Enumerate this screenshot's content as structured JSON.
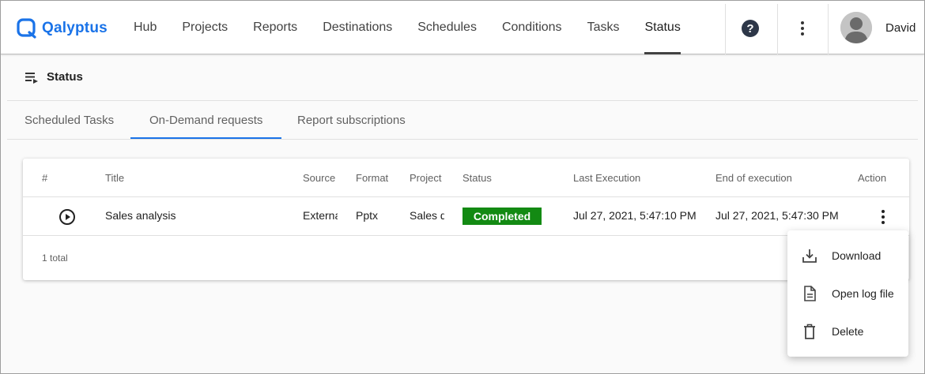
{
  "app": {
    "brand": "Qalyptus",
    "brand_color": "#1a73e8"
  },
  "nav": {
    "items": [
      {
        "label": "Hub"
      },
      {
        "label": "Projects"
      },
      {
        "label": "Reports"
      },
      {
        "label": "Destinations"
      },
      {
        "label": "Schedules"
      },
      {
        "label": "Conditions"
      },
      {
        "label": "Tasks"
      },
      {
        "label": "Status",
        "active": true
      }
    ],
    "help_label": "?",
    "help_icon": "help-circle-icon",
    "more_icon": "more-vertical-icon",
    "user_name": "David",
    "avatar_icon": "user-avatar-icon"
  },
  "page": {
    "title": "Status",
    "title_icon": "playlist-play-icon"
  },
  "tabs": [
    {
      "label": "Scheduled Tasks"
    },
    {
      "label": "On-Demand requests",
      "active": true
    },
    {
      "label": "Report subscriptions"
    }
  ],
  "table": {
    "columns": [
      "#",
      "Title",
      "Source",
      "Format",
      "Project",
      "Status",
      "Last Execution",
      "End of execution",
      "Action"
    ],
    "rows": [
      {
        "run_icon": "play-circle-icon",
        "title": "Sales analysis",
        "source": "External",
        "format": "Pptx",
        "project": "Sales dashboard",
        "status": "Completed",
        "status_color": "#138a13",
        "last_execution": "Jul 27, 2021, 5:47:10 PM",
        "end_of_execution": "Jul 27, 2021, 5:47:30 PM",
        "action_icon": "more-vertical-icon"
      }
    ],
    "total": "1 total"
  },
  "menu": {
    "items": [
      {
        "label": "Download",
        "icon": "download-icon"
      },
      {
        "label": "Open log file",
        "icon": "file-document-icon"
      },
      {
        "label": "Delete",
        "icon": "trash-icon"
      }
    ]
  }
}
